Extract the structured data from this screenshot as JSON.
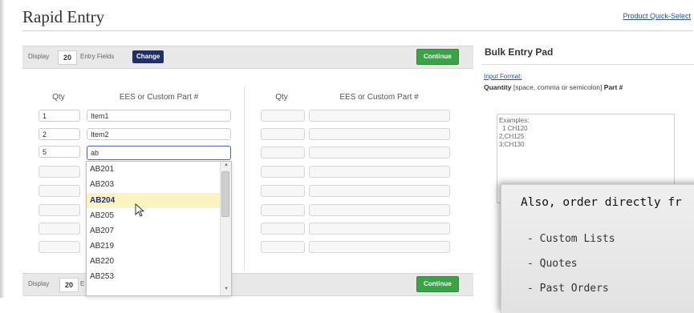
{
  "header": {
    "title": "Rapid Entry",
    "quick_select_link": "Product Quick-Select"
  },
  "bar": {
    "display_label": "Display",
    "count": "20",
    "entry_fields_label": "Entry Fields",
    "change_label": "Change",
    "continue_label": "Continue",
    "bottom_truncated_label": "E"
  },
  "columns": {
    "qty": "Qty",
    "part": "EES or Custom Part #"
  },
  "left_rows": [
    {
      "qty": "1",
      "part": "Item1"
    },
    {
      "qty": "2",
      "part": "Item2"
    },
    {
      "qty": "5",
      "part": "ab"
    }
  ],
  "dropdown": {
    "items": [
      "AB201",
      "AB203",
      "AB204",
      "AB205",
      "AB207",
      "AB219",
      "AB220",
      "AB253"
    ],
    "highlighted": "AB204"
  },
  "bulk_pad": {
    "title": "Bulk Entry Pad",
    "input_format_link": "Input Format:",
    "format_quantity": "Quantity",
    "format_separators": "[space, comma or semicolon]",
    "format_part": "Part #",
    "examples_label": "Examples:",
    "examples": [
      "1 CH120",
      "2,CH125",
      "3;CH130"
    ]
  },
  "promo": {
    "title": "Also, order directly fr",
    "items": [
      "- Custom Lists",
      "- Quotes",
      "- Past Orders"
    ]
  }
}
